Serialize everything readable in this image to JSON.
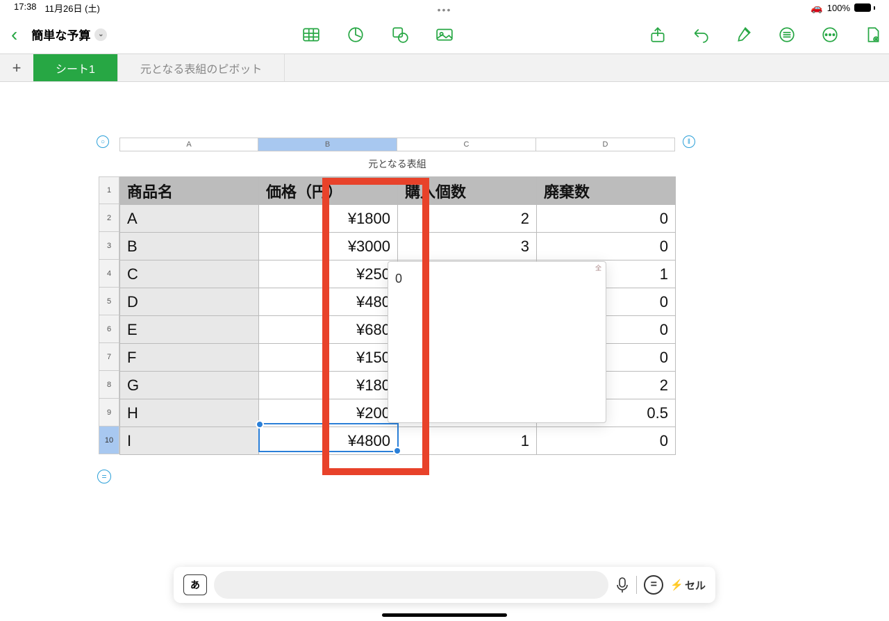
{
  "status": {
    "time": "17:38",
    "date": "11月26日 (土)",
    "battery_pct": "100%"
  },
  "toolbar": {
    "doc_title": "簡単な予算"
  },
  "tabs": {
    "add": "+",
    "items": [
      {
        "label": "シート1",
        "active": true
      },
      {
        "label": "元となる表組のピボット",
        "active": false
      }
    ]
  },
  "sheet": {
    "title": "元となる表組",
    "col_letters": [
      "A",
      "B",
      "C",
      "D"
    ],
    "row_numbers": [
      "1",
      "2",
      "3",
      "4",
      "5",
      "6",
      "7",
      "8",
      "9",
      "10"
    ],
    "headers": [
      "商品名",
      "価格（円）",
      "購入個数",
      "廃棄数"
    ],
    "rows": [
      {
        "name": "A",
        "price": "¥1800",
        "qty": "2",
        "waste": "0"
      },
      {
        "name": "B",
        "price": "¥3000",
        "qty": "3",
        "waste": "0"
      },
      {
        "name": "C",
        "price": "¥250",
        "qty": "",
        "waste": "1"
      },
      {
        "name": "D",
        "price": "¥480",
        "qty": "",
        "waste": "0"
      },
      {
        "name": "E",
        "price": "¥680",
        "qty": "",
        "waste": "0"
      },
      {
        "name": "F",
        "price": "¥150",
        "qty": "",
        "waste": "0"
      },
      {
        "name": "G",
        "price": "¥180",
        "qty": "",
        "waste": "2"
      },
      {
        "name": "H",
        "price": "¥200",
        "qty": "",
        "waste": "0.5"
      },
      {
        "name": "I",
        "price": "¥4800",
        "qty": "1",
        "waste": "0"
      }
    ],
    "popup_value": "0",
    "selected_column": "B",
    "selected_row": "10"
  },
  "input_bar": {
    "kbd_mode": "あ",
    "cell_button": "セル",
    "equals": "="
  }
}
